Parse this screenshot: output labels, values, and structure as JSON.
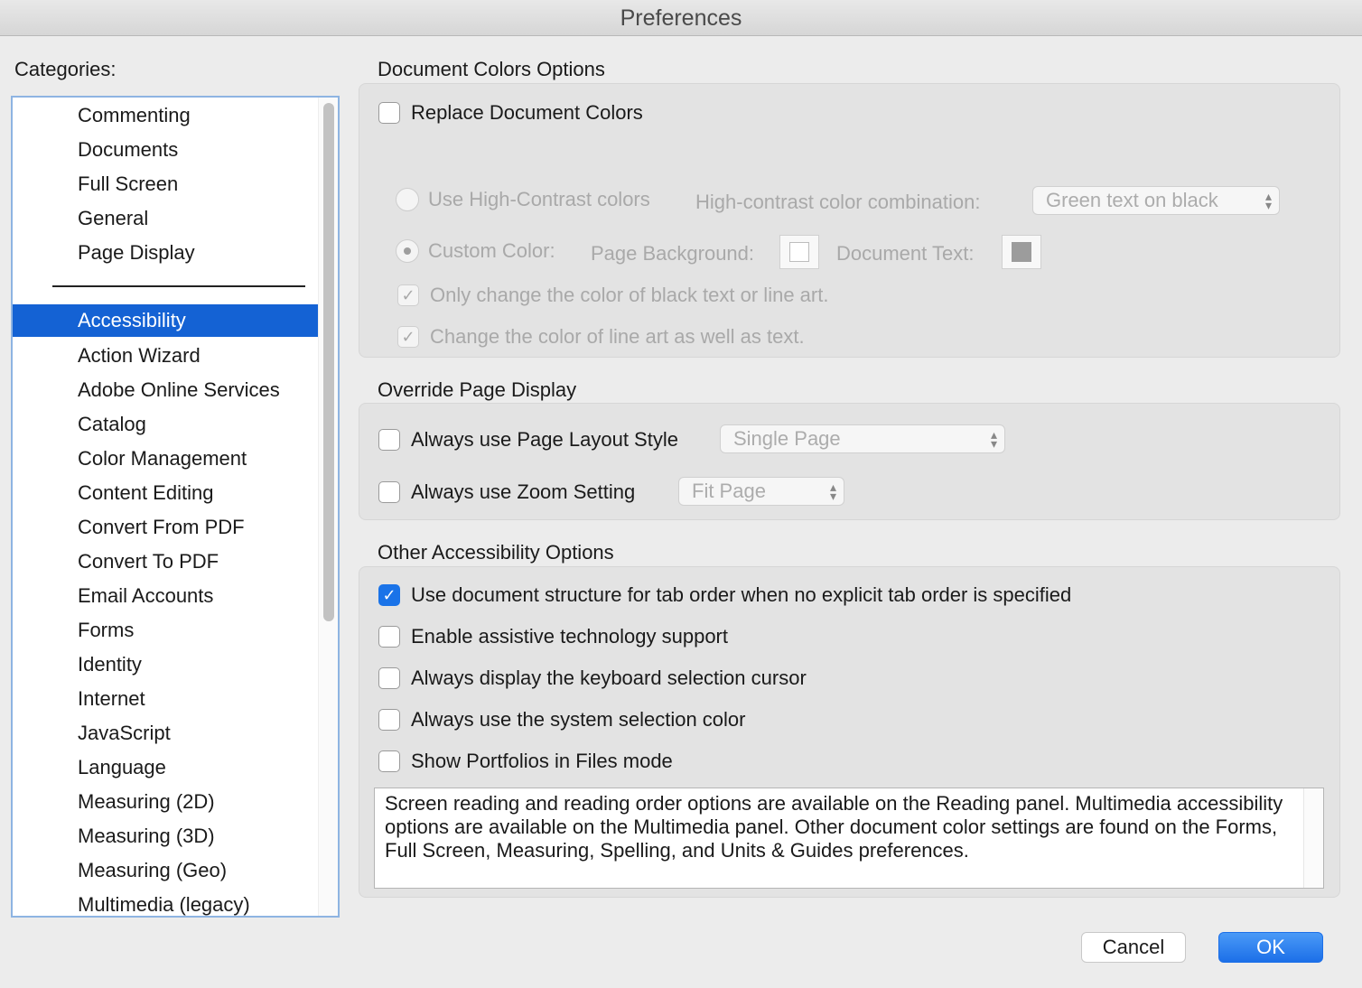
{
  "window": {
    "title": "Preferences"
  },
  "sidebar": {
    "label": "Categories:",
    "items": [
      "Commenting",
      "Documents",
      "Full Screen",
      "General",
      "Page Display",
      "Accessibility",
      "Action Wizard",
      "Adobe Online Services",
      "Catalog",
      "Color Management",
      "Content Editing",
      "Convert From PDF",
      "Convert To PDF",
      "Email Accounts",
      "Forms",
      "Identity",
      "Internet",
      "JavaScript",
      "Language",
      "Measuring (2D)",
      "Measuring (3D)",
      "Measuring (Geo)",
      "Multimedia (legacy)"
    ],
    "selected": "Accessibility"
  },
  "doc_colors": {
    "title": "Document Colors Options",
    "replace_label": "Replace Document Colors",
    "high_contrast_label": "Use High-Contrast colors",
    "combination_label": "High-contrast color combination:",
    "combination_value": "Green text on black",
    "custom_label": "Custom Color:",
    "page_bg_label": "Page Background:",
    "doc_text_label": "Document Text:",
    "only_black_label": "Only change the color of black text or line art.",
    "line_art_label": "Change the color of line art as well as text."
  },
  "override": {
    "title": "Override Page Display",
    "layout_label": "Always use Page Layout Style",
    "layout_value": "Single Page",
    "zoom_label": "Always use Zoom Setting",
    "zoom_value": "Fit Page"
  },
  "other": {
    "title": "Other Accessibility Options",
    "tab_order_label": "Use document structure for tab order when no explicit tab order is specified",
    "assistive_label": "Enable assistive technology support",
    "cursor_label": "Always display the keyboard selection cursor",
    "system_color_label": "Always use the system selection color",
    "portfolios_label": "Show Portfolios in Files mode",
    "note": "Screen reading and reading order options are available on the Reading panel. Multimedia accessibility options are available on the Multimedia panel. Other document color settings are found on the Forms, Full Screen, Measuring, Spelling, and Units & Guides preferences."
  },
  "buttons": {
    "cancel": "Cancel",
    "ok": "OK"
  },
  "colors": {
    "accent": "#1462d4",
    "checkbox_checked": "#1a73e8"
  }
}
